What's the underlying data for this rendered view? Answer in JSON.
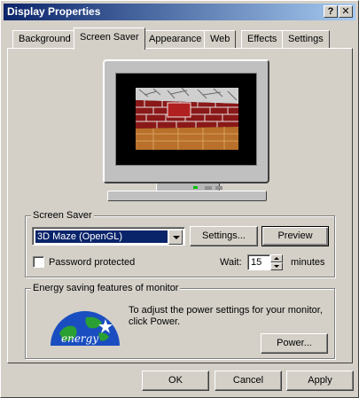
{
  "window": {
    "title": "Display Properties"
  },
  "titlebar_buttons": {
    "help": "?",
    "close": "X"
  },
  "tabs": [
    {
      "label": "Background"
    },
    {
      "label": "Screen Saver"
    },
    {
      "label": "Appearance"
    },
    {
      "label": "Web"
    },
    {
      "label": "Effects"
    },
    {
      "label": "Settings"
    }
  ],
  "active_tab": "Screen Saver",
  "screen_saver": {
    "group_label": "Screen Saver",
    "selected": "3D Maze (OpenGL)",
    "settings_button": "Settings...",
    "preview_button": "Preview",
    "password_label": "Password protected",
    "password_checked": false,
    "wait_label": "Wait:",
    "wait_value": "15",
    "wait_unit": "minutes"
  },
  "energy": {
    "group_label": "Energy saving features of monitor",
    "description": "To adjust the power settings for your monitor, click Power.",
    "power_button": "Power...",
    "logo_text": "energy"
  },
  "footer": {
    "ok": "OK",
    "cancel": "Cancel",
    "apply": "Apply"
  },
  "icons": {
    "logo": "energy-star-logo",
    "monitor": "monitor-preview"
  }
}
